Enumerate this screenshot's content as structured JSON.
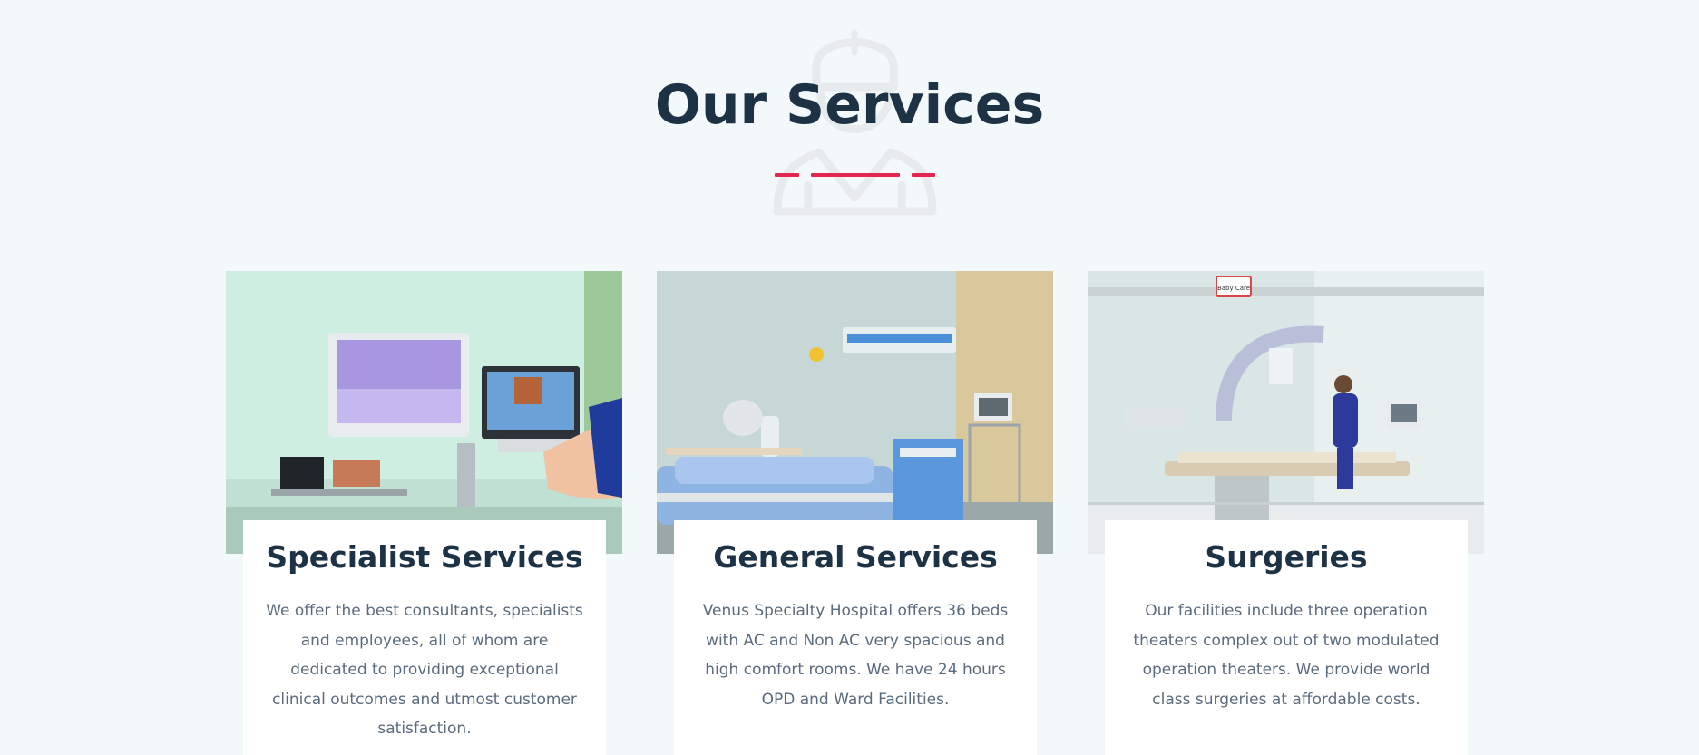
{
  "section": {
    "title": "Our Services",
    "background_icon": "nurse-outline-icon",
    "accent_color": "#e4254f",
    "title_color": "#1e3245"
  },
  "cards": [
    {
      "image": "specialist-equipment-photo",
      "title": "Specialist Services",
      "description": "We offer the best consultants, specialists and employees, all of whom are dedicated to providing exceptional clinical outcomes and utmost customer satisfaction."
    },
    {
      "image": "hospital-ward-bed-photo",
      "title": "General Services",
      "description": "Venus Specialty Hospital offers 36 beds with AC and Non AC very spacious and high comfort rooms. We have 24 hours OPD and Ward Facilities."
    },
    {
      "image": "operation-theater-photo",
      "title": "Surgeries",
      "description": "Our facilities include three operation theaters complex out of two modulated operation theaters. We provide world class surgeries at affordable costs.",
      "sign_text": "Baby Care"
    }
  ]
}
